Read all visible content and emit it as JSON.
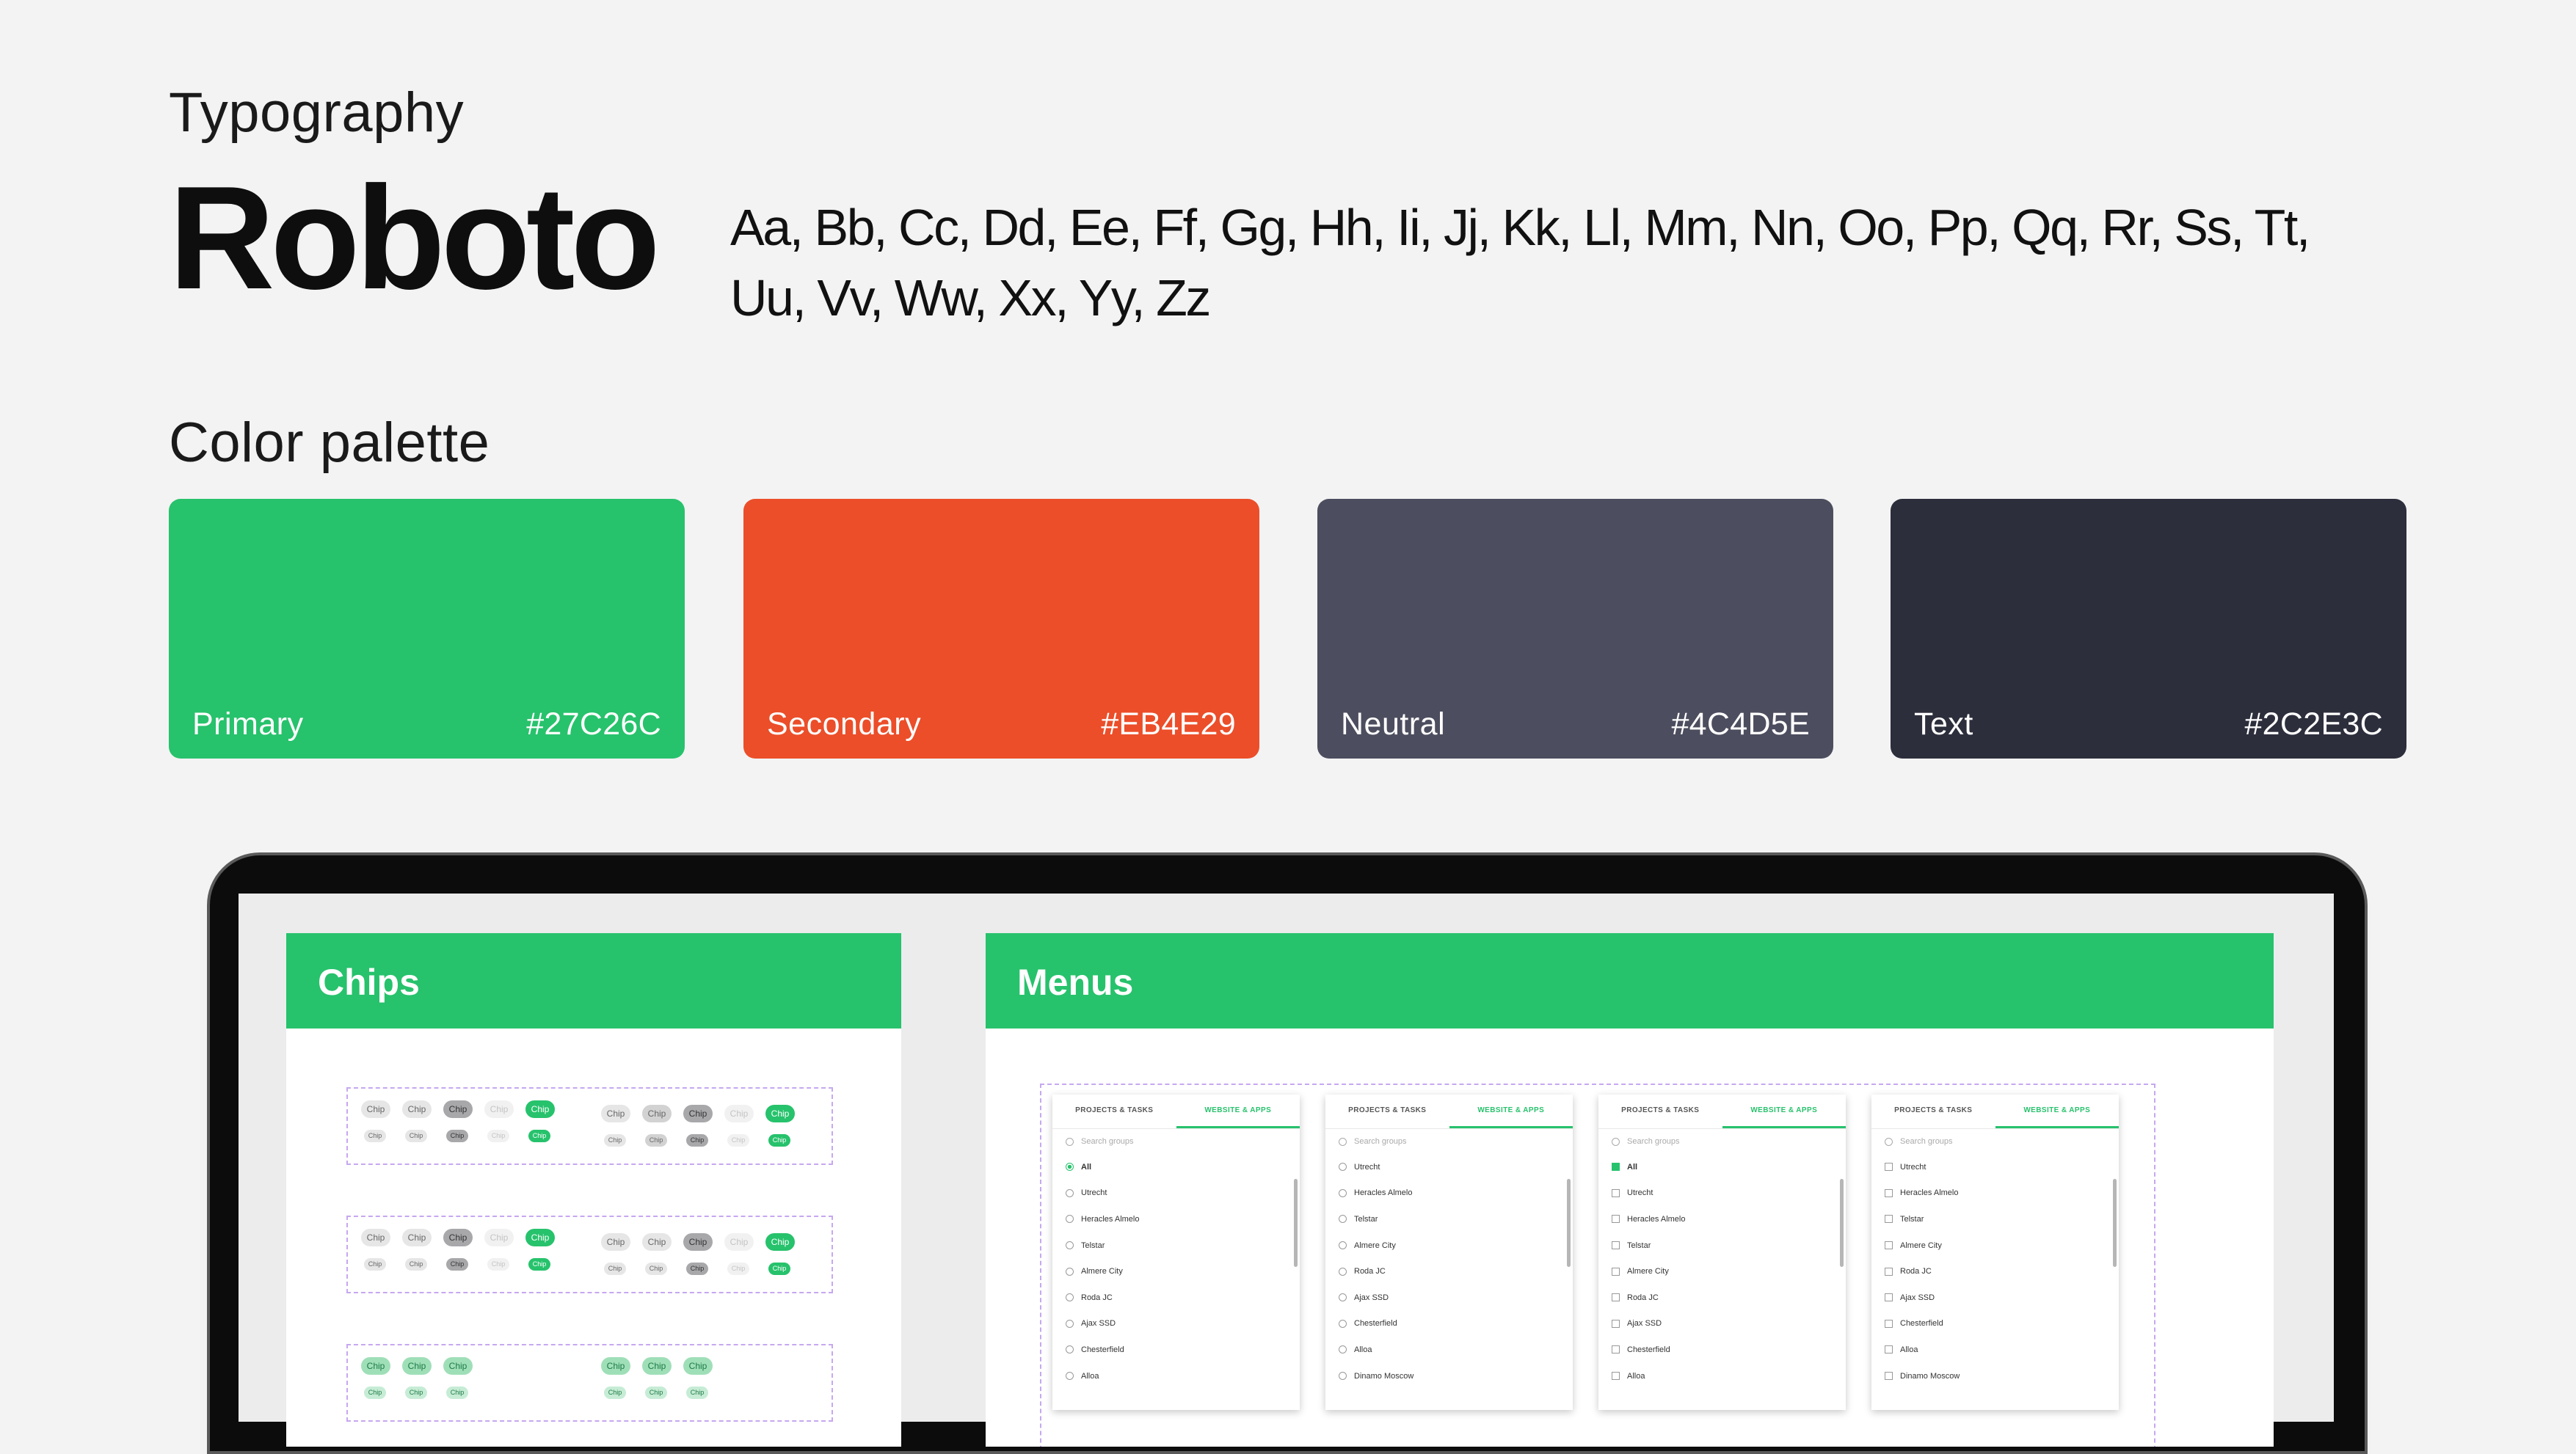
{
  "typography": {
    "heading": "Typography",
    "font_name": "Roboto",
    "alphabet": "Aa, Bb, Cc, Dd, Ee, Ff, Gg, Hh, Ii, Jj, Kk, Ll, Mm, Nn, Oo, Pp,  Qq, Rr, Ss, Tt, Uu, Vv, Ww, Xx, Yy, Zz"
  },
  "palette": {
    "heading": "Color palette",
    "swatches": [
      {
        "name": "Primary",
        "hex": "#27C26C",
        "color": "#27C26C"
      },
      {
        "name": "Secondary",
        "hex": "#EB4E29",
        "color": "#EB4E29"
      },
      {
        "name": "Neutral",
        "hex": "#4C4D5E",
        "color": "#4C4D5E"
      },
      {
        "name": "Text",
        "hex": "#2C2E3C",
        "color": "#2C2E3C"
      }
    ]
  },
  "chips_panel": {
    "title": "Chips",
    "chip_label": "Chip"
  },
  "menus_panel": {
    "title": "Menus",
    "tab_one": "PROJECTS & TASKS",
    "tab_two": "WEBSITE & APPS",
    "search_placeholder": "Search groups",
    "items_a": [
      "All",
      "Utrecht",
      "Heracles Almelo",
      "Telstar",
      "Almere City",
      "Roda JC",
      "Ajax SSD",
      "Chesterfield",
      "Alloa"
    ],
    "items_b": [
      "Utrecht",
      "Heracles Almelo",
      "Telstar",
      "Almere City",
      "Roda JC",
      "Ajax SSD",
      "Chesterfield",
      "Alloa",
      "Dinamo Moscow"
    ]
  }
}
